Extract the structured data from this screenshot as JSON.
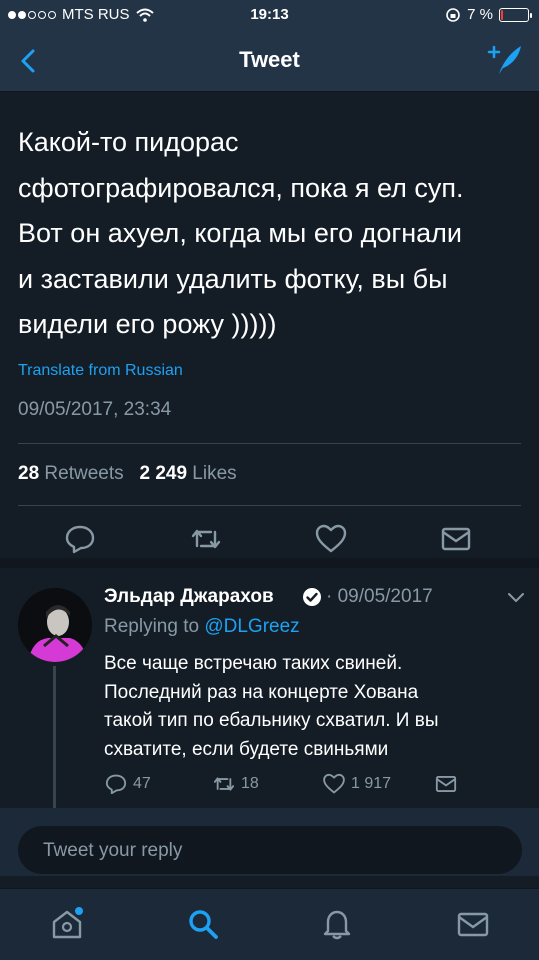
{
  "status_bar": {
    "carrier": "MTS RUS",
    "time": "19:13",
    "battery": "7 %",
    "battery_level": 0.07
  },
  "nav": {
    "title": "Tweet",
    "back_icon": "chevron-left-icon",
    "compose_icon": "compose-tweet-icon"
  },
  "tweet": {
    "lines": [
      "Какой-то пидорас",
      "сфотографировался, пока я ел суп.",
      "Вот он ахуел, когда мы его догнали",
      "и заставили удалить фотку, вы бы",
      "видели его рожу )))))"
    ],
    "translate": "Translate from Russian",
    "timestamp": "09/05/2017, 23:34",
    "retweets_count": "28",
    "retweets_label": "Retweets",
    "likes_count": "2 249",
    "likes_label": "Likes"
  },
  "reply": {
    "name": "Эльдар Джарахов",
    "date": "· 09/05/2017",
    "replying_prefix": "Replying to",
    "replying_handle": "@DLGreez",
    "lines": [
      "Все чаще встречаю таких свиней.",
      "Последний раз на концерте Хована",
      "такой тип по ебальнику схватил. И вы",
      "схватите, если будете свиньями"
    ],
    "reply_count": "47",
    "retweet_count": "18",
    "like_count": "1 917"
  },
  "compose": {
    "placeholder": "Tweet your reply"
  },
  "colors": {
    "accent": "#1da1f2",
    "background": "#141d26",
    "bar": "#243447",
    "muted": "#8899a6"
  }
}
